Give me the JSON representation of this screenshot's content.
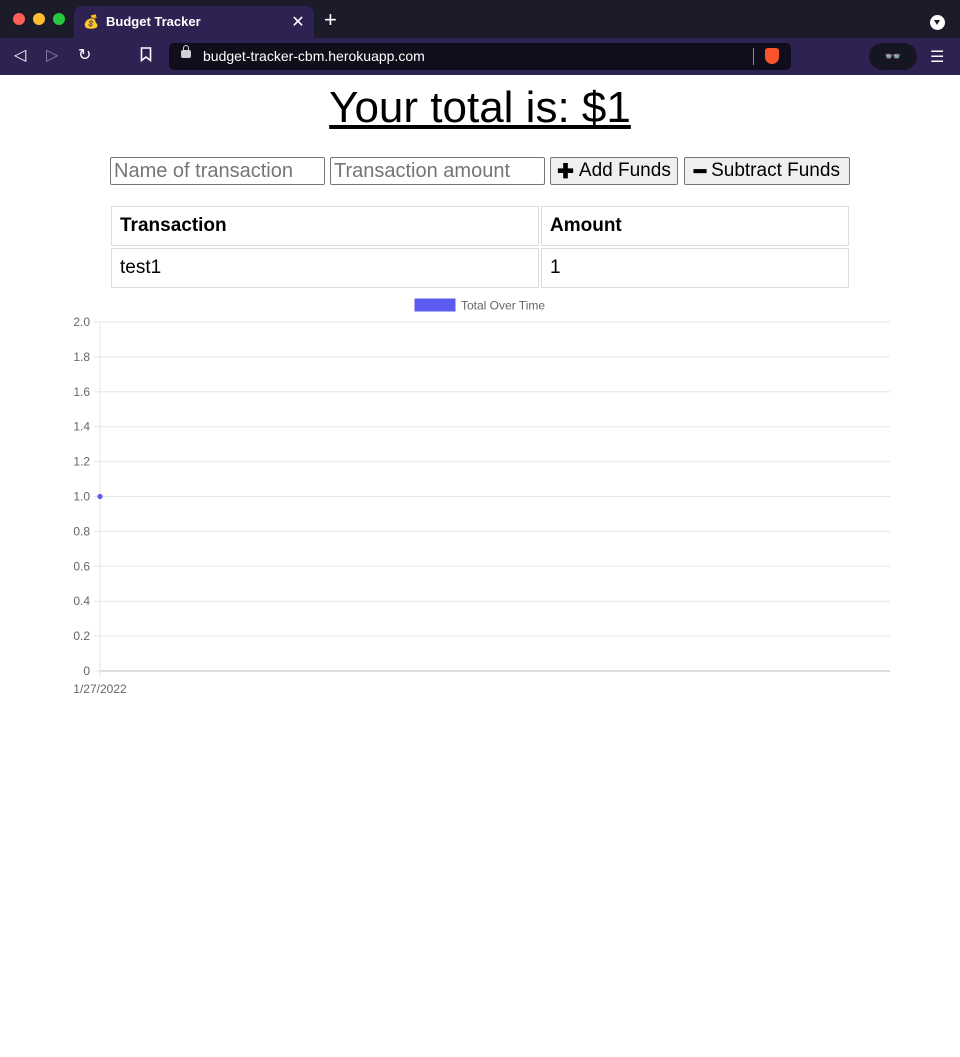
{
  "browser": {
    "tab_title": "Budget Tracker",
    "tab_favicon": "money-bag-icon",
    "url": "budget-tracker-cbm.herokuapp.com"
  },
  "page": {
    "total_heading": "Your total is: $1",
    "name_placeholder": "Name of transaction",
    "amount_placeholder": "Transaction amount",
    "add_label": "Add Funds",
    "subtract_label": "Subtract Funds"
  },
  "table": {
    "headers": [
      "Transaction",
      "Amount"
    ],
    "rows": [
      {
        "name": "test1",
        "amount": "1"
      }
    ]
  },
  "chart_data": {
    "type": "line",
    "legend": "Total Over Time",
    "series_color": "#5b5bf0",
    "x": [
      "1/27/2022"
    ],
    "series": [
      {
        "name": "Total Over Time",
        "values": [
          1
        ]
      }
    ],
    "ylim": [
      0,
      2
    ],
    "yticks": [
      "2.0",
      "1.8",
      "1.6",
      "1.4",
      "1.2",
      "1.0",
      "0.8",
      "0.6",
      "0.4",
      "0.2",
      "0"
    ],
    "grid": true,
    "legend_position": "top-center"
  }
}
